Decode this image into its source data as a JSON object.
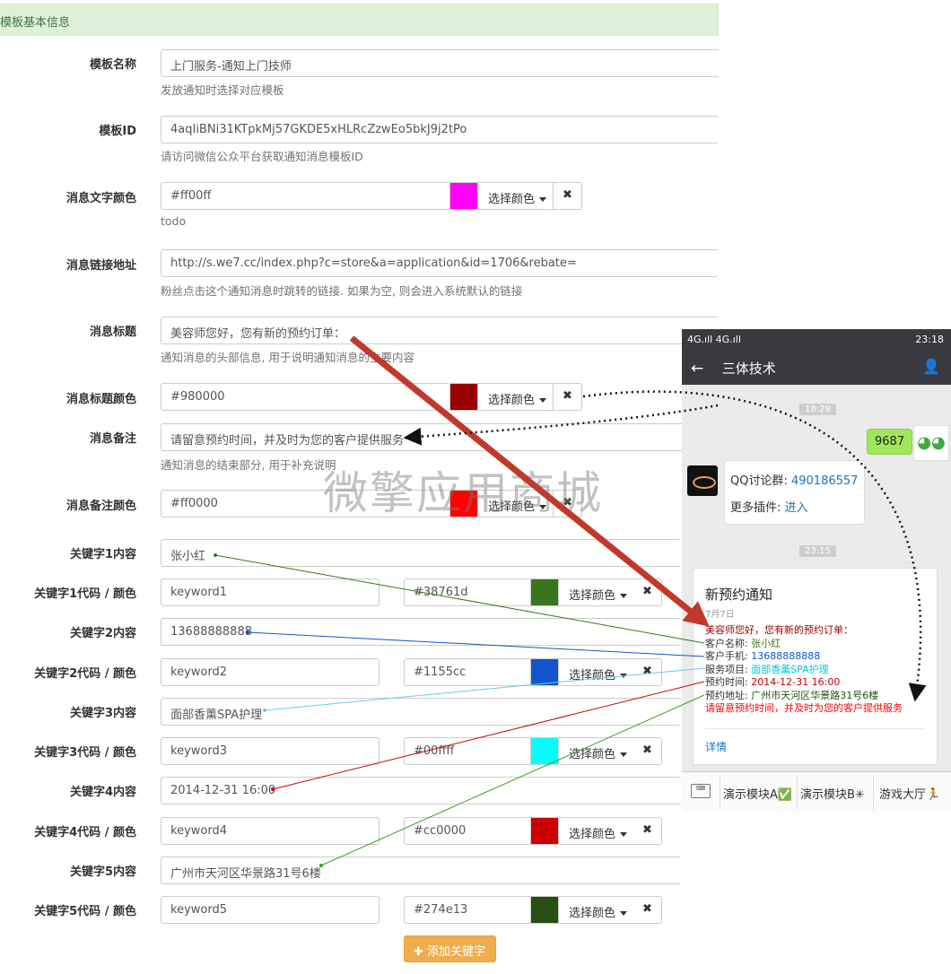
{
  "panel": {
    "title": "模板基本信息"
  },
  "fields": {
    "template_name": {
      "label": "模板名称",
      "value": "上门服务-通知上门技师",
      "help": "发放通知时选择对应模板"
    },
    "template_id": {
      "label": "模板ID",
      "value": "4aqIiBNi31KTpkMj57GKDE5xHLRcZzwEo5bkJ9j2tPo",
      "help": "请访问微信公众平台获取通知消息模板ID"
    },
    "text_color": {
      "label": "消息文字颜色",
      "value": "#ff00ff",
      "help": "todo",
      "swatch": "#ff00ff"
    },
    "link": {
      "label": "消息链接地址",
      "value": "http://s.we7.cc/index.php?c=store&a=application&id=1706&rebate=",
      "help": "粉丝点击这个通知消息时跳转的链接. 如果为空, 则会进入系统默认的链接"
    },
    "msg_title": {
      "label": "消息标题",
      "value": "美容师您好，您有新的预约订单：",
      "help": "通知消息的头部信息, 用于说明通知消息的主要内容"
    },
    "title_color": {
      "label": "消息标题颜色",
      "value": "#980000",
      "swatch": "#980000"
    },
    "remark": {
      "label": "消息备注",
      "value": "请留意预约时间，并及时为您的客户提供服务",
      "help": "通知消息的结束部分, 用于补充说明"
    },
    "remark_color": {
      "label": "消息备注颜色",
      "value": "#ff0000",
      "swatch": "#ff0000"
    }
  },
  "keywords": [
    {
      "content_label": "关键字1内容",
      "content": "张小红",
      "code_label": "关键字1代码 / 颜色",
      "code": "keyword1",
      "color": "#38761d"
    },
    {
      "content_label": "关键字2内容",
      "content": "13688888888",
      "code_label": "关键字2代码 / 颜色",
      "code": "keyword2",
      "color": "#1155cc"
    },
    {
      "content_label": "关键字3内容",
      "content": "面部香薰SPA护理",
      "code_label": "关键字3代码 / 颜色",
      "code": "keyword3",
      "color": "#00ffff"
    },
    {
      "content_label": "关键字4内容",
      "content": "2014-12-31 16:00",
      "code_label": "关键字4代码 / 颜色",
      "code": "keyword4",
      "color": "#cc0000"
    },
    {
      "content_label": "关键字5内容",
      "content": "广州市天河区华景路31号6楼",
      "code_label": "关键字5代码 / 颜色",
      "code": "keyword5",
      "color": "#274e13"
    }
  ],
  "buttons": {
    "pick_color": "选择颜色",
    "clear": "✖",
    "add_keyword": "添加关键字"
  },
  "watermark": "微擎应用商城",
  "phone": {
    "status_left": "4G.ıll 4G.ıll",
    "time": "23:18",
    "chat_title": "三体技术",
    "ts1": "18:29",
    "my_msg": "9687",
    "bot_line1_prefix": "QQ讨论群: ",
    "bot_line1_link": "490186557",
    "bot_line2_prefix": "更多插件: ",
    "bot_line2_link": "进入",
    "ts2": "23:15",
    "card": {
      "title": "新预约通知",
      "date": "7月7日",
      "first": "美容师您好，您有新的预约订单：",
      "k1_label": "客户名称: ",
      "k1": "张小红",
      "k2_label": "客户手机: ",
      "k2": "13688888888",
      "k3_label": "服务项目: ",
      "k3": "面部香薰SPA护理",
      "k4_label": "预约时间: ",
      "k4": "2014-12-31 16:00",
      "k5_label": "预约地址: ",
      "k5": "广州市天河区华景路31号6楼",
      "remark": "请留意预约时间，并及时为您的客户提供服务",
      "detail": "详情"
    },
    "menu": [
      "演示模块A✅",
      "演示模块B✳",
      "游戏大厅🏃"
    ]
  }
}
